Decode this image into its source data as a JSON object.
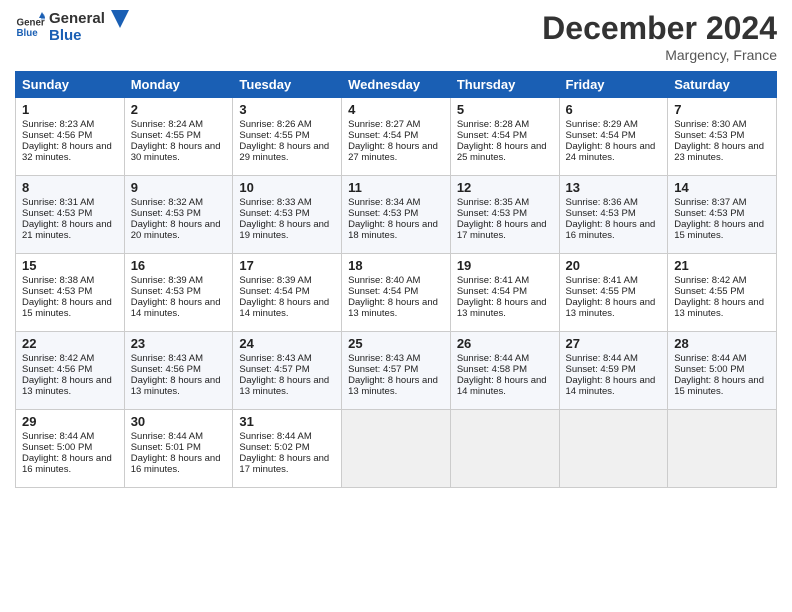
{
  "header": {
    "logo_general": "General",
    "logo_blue": "Blue",
    "month_title": "December 2024",
    "location": "Margency, France"
  },
  "days_of_week": [
    "Sunday",
    "Monday",
    "Tuesday",
    "Wednesday",
    "Thursday",
    "Friday",
    "Saturday"
  ],
  "weeks": [
    [
      {
        "day": "1",
        "sunrise": "8:23 AM",
        "sunset": "4:56 PM",
        "daylight_h": "8",
        "daylight_m": "32"
      },
      {
        "day": "2",
        "sunrise": "8:24 AM",
        "sunset": "4:55 PM",
        "daylight_h": "8",
        "daylight_m": "30"
      },
      {
        "day": "3",
        "sunrise": "8:26 AM",
        "sunset": "4:55 PM",
        "daylight_h": "8",
        "daylight_m": "29"
      },
      {
        "day": "4",
        "sunrise": "8:27 AM",
        "sunset": "4:54 PM",
        "daylight_h": "8",
        "daylight_m": "27"
      },
      {
        "day": "5",
        "sunrise": "8:28 AM",
        "sunset": "4:54 PM",
        "daylight_h": "8",
        "daylight_m": "25"
      },
      {
        "day": "6",
        "sunrise": "8:29 AM",
        "sunset": "4:54 PM",
        "daylight_h": "8",
        "daylight_m": "24"
      },
      {
        "day": "7",
        "sunrise": "8:30 AM",
        "sunset": "4:53 PM",
        "daylight_h": "8",
        "daylight_m": "23"
      }
    ],
    [
      {
        "day": "8",
        "sunrise": "8:31 AM",
        "sunset": "4:53 PM",
        "daylight_h": "8",
        "daylight_m": "21"
      },
      {
        "day": "9",
        "sunrise": "8:32 AM",
        "sunset": "4:53 PM",
        "daylight_h": "8",
        "daylight_m": "20"
      },
      {
        "day": "10",
        "sunrise": "8:33 AM",
        "sunset": "4:53 PM",
        "daylight_h": "8",
        "daylight_m": "19"
      },
      {
        "day": "11",
        "sunrise": "8:34 AM",
        "sunset": "4:53 PM",
        "daylight_h": "8",
        "daylight_m": "18"
      },
      {
        "day": "12",
        "sunrise": "8:35 AM",
        "sunset": "4:53 PM",
        "daylight_h": "8",
        "daylight_m": "17"
      },
      {
        "day": "13",
        "sunrise": "8:36 AM",
        "sunset": "4:53 PM",
        "daylight_h": "8",
        "daylight_m": "16"
      },
      {
        "day": "14",
        "sunrise": "8:37 AM",
        "sunset": "4:53 PM",
        "daylight_h": "8",
        "daylight_m": "15"
      }
    ],
    [
      {
        "day": "15",
        "sunrise": "8:38 AM",
        "sunset": "4:53 PM",
        "daylight_h": "8",
        "daylight_m": "15"
      },
      {
        "day": "16",
        "sunrise": "8:39 AM",
        "sunset": "4:53 PM",
        "daylight_h": "8",
        "daylight_m": "14"
      },
      {
        "day": "17",
        "sunrise": "8:39 AM",
        "sunset": "4:54 PM",
        "daylight_h": "8",
        "daylight_m": "14"
      },
      {
        "day": "18",
        "sunrise": "8:40 AM",
        "sunset": "4:54 PM",
        "daylight_h": "8",
        "daylight_m": "13"
      },
      {
        "day": "19",
        "sunrise": "8:41 AM",
        "sunset": "4:54 PM",
        "daylight_h": "8",
        "daylight_m": "13"
      },
      {
        "day": "20",
        "sunrise": "8:41 AM",
        "sunset": "4:55 PM",
        "daylight_h": "8",
        "daylight_m": "13"
      },
      {
        "day": "21",
        "sunrise": "8:42 AM",
        "sunset": "4:55 PM",
        "daylight_h": "8",
        "daylight_m": "13"
      }
    ],
    [
      {
        "day": "22",
        "sunrise": "8:42 AM",
        "sunset": "4:56 PM",
        "daylight_h": "8",
        "daylight_m": "13"
      },
      {
        "day": "23",
        "sunrise": "8:43 AM",
        "sunset": "4:56 PM",
        "daylight_h": "8",
        "daylight_m": "13"
      },
      {
        "day": "24",
        "sunrise": "8:43 AM",
        "sunset": "4:57 PM",
        "daylight_h": "8",
        "daylight_m": "13"
      },
      {
        "day": "25",
        "sunrise": "8:43 AM",
        "sunset": "4:57 PM",
        "daylight_h": "8",
        "daylight_m": "13"
      },
      {
        "day": "26",
        "sunrise": "8:44 AM",
        "sunset": "4:58 PM",
        "daylight_h": "8",
        "daylight_m": "14"
      },
      {
        "day": "27",
        "sunrise": "8:44 AM",
        "sunset": "4:59 PM",
        "daylight_h": "8",
        "daylight_m": "14"
      },
      {
        "day": "28",
        "sunrise": "8:44 AM",
        "sunset": "5:00 PM",
        "daylight_h": "8",
        "daylight_m": "15"
      }
    ],
    [
      {
        "day": "29",
        "sunrise": "8:44 AM",
        "sunset": "5:00 PM",
        "daylight_h": "8",
        "daylight_m": "16"
      },
      {
        "day": "30",
        "sunrise": "8:44 AM",
        "sunset": "5:01 PM",
        "daylight_h": "8",
        "daylight_m": "16"
      },
      {
        "day": "31",
        "sunrise": "8:44 AM",
        "sunset": "5:02 PM",
        "daylight_h": "8",
        "daylight_m": "17"
      },
      null,
      null,
      null,
      null
    ]
  ],
  "labels": {
    "sunrise": "Sunrise:",
    "sunset": "Sunset:",
    "daylight": "Daylight: ",
    "hours": "hours",
    "and": "and",
    "minutes": "minutes."
  }
}
